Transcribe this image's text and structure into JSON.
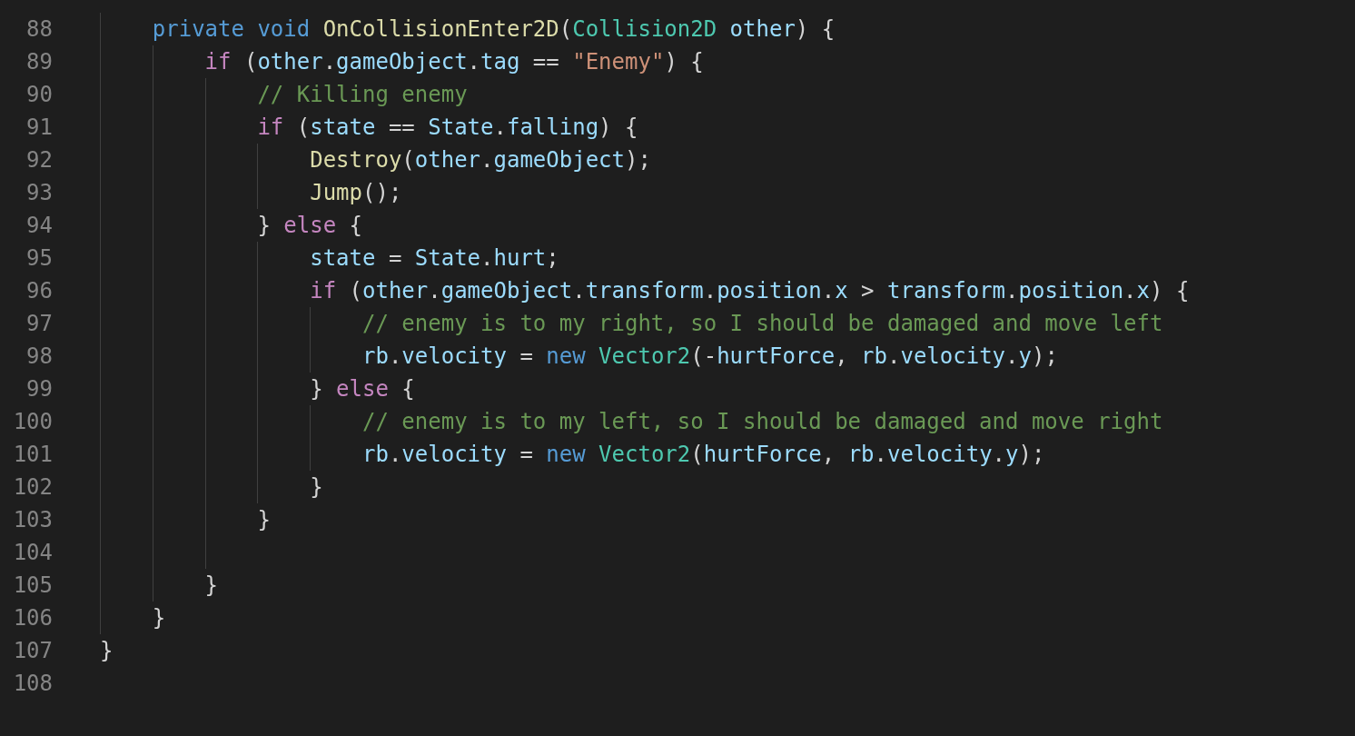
{
  "editor": {
    "lines": [
      {
        "children": [
          {
            "number": "88",
            "tokens": [
              {
                "kind": "keyword",
                "text": "private "
              },
              {
                "kind": "keyword",
                "text": "void "
              },
              {
                "kind": "function",
                "text": "OnCollisionEnter2D"
              },
              {
                "kind": "plain",
                "text": "("
              },
              {
                "kind": "type",
                "text": "Collision2D "
              },
              {
                "kind": "variable",
                "text": "other"
              },
              {
                "kind": "plain",
                "text": ") {"
              }
            ],
            "children": [
              {
                "number": "89",
                "tokens": [
                  {
                    "kind": "control",
                    "text": "if"
                  },
                  {
                    "kind": "plain",
                    "text": " ("
                  },
                  {
                    "kind": "variable",
                    "text": "other"
                  },
                  {
                    "kind": "plain",
                    "text": "."
                  },
                  {
                    "kind": "variable",
                    "text": "gameObject"
                  },
                  {
                    "kind": "plain",
                    "text": "."
                  },
                  {
                    "kind": "variable",
                    "text": "tag"
                  },
                  {
                    "kind": "plain",
                    "text": " == "
                  },
                  {
                    "kind": "string",
                    "text": "\"Enemy\""
                  },
                  {
                    "kind": "plain",
                    "text": ") {"
                  }
                ],
                "children": [
                  {
                    "number": "90",
                    "tokens": [
                      {
                        "kind": "comment",
                        "text": "// Killing enemy"
                      }
                    ]
                  },
                  {
                    "number": "91",
                    "tokens": [
                      {
                        "kind": "control",
                        "text": "if"
                      },
                      {
                        "kind": "plain",
                        "text": " ("
                      },
                      {
                        "kind": "variable",
                        "text": "state"
                      },
                      {
                        "kind": "plain",
                        "text": " == "
                      },
                      {
                        "kind": "variable",
                        "text": "State"
                      },
                      {
                        "kind": "plain",
                        "text": "."
                      },
                      {
                        "kind": "variable",
                        "text": "falling"
                      },
                      {
                        "kind": "plain",
                        "text": ") {"
                      }
                    ],
                    "children": [
                      {
                        "number": "92",
                        "tokens": [
                          {
                            "kind": "function",
                            "text": "Destroy"
                          },
                          {
                            "kind": "plain",
                            "text": "("
                          },
                          {
                            "kind": "variable",
                            "text": "other"
                          },
                          {
                            "kind": "plain",
                            "text": "."
                          },
                          {
                            "kind": "variable",
                            "text": "gameObject"
                          },
                          {
                            "kind": "plain",
                            "text": ");"
                          }
                        ]
                      },
                      {
                        "number": "93",
                        "tokens": [
                          {
                            "kind": "function",
                            "text": "Jump"
                          },
                          {
                            "kind": "plain",
                            "text": "();"
                          }
                        ]
                      }
                    ]
                  },
                  {
                    "number": "94",
                    "tokens": [
                      {
                        "kind": "plain",
                        "text": "} "
                      },
                      {
                        "kind": "control",
                        "text": "else"
                      },
                      {
                        "kind": "plain",
                        "text": " {"
                      }
                    ],
                    "children": [
                      {
                        "number": "95",
                        "tokens": [
                          {
                            "kind": "variable",
                            "text": "state"
                          },
                          {
                            "kind": "plain",
                            "text": " = "
                          },
                          {
                            "kind": "variable",
                            "text": "State"
                          },
                          {
                            "kind": "plain",
                            "text": "."
                          },
                          {
                            "kind": "variable",
                            "text": "hurt"
                          },
                          {
                            "kind": "plain",
                            "text": ";"
                          }
                        ]
                      },
                      {
                        "number": "96",
                        "tokens": [
                          {
                            "kind": "control",
                            "text": "if"
                          },
                          {
                            "kind": "plain",
                            "text": " ("
                          },
                          {
                            "kind": "variable",
                            "text": "other"
                          },
                          {
                            "kind": "plain",
                            "text": "."
                          },
                          {
                            "kind": "variable",
                            "text": "gameObject"
                          },
                          {
                            "kind": "plain",
                            "text": "."
                          },
                          {
                            "kind": "variable",
                            "text": "transform"
                          },
                          {
                            "kind": "plain",
                            "text": "."
                          },
                          {
                            "kind": "variable",
                            "text": "position"
                          },
                          {
                            "kind": "plain",
                            "text": "."
                          },
                          {
                            "kind": "variable",
                            "text": "x"
                          },
                          {
                            "kind": "plain",
                            "text": " > "
                          },
                          {
                            "kind": "variable",
                            "text": "transform"
                          },
                          {
                            "kind": "plain",
                            "text": "."
                          },
                          {
                            "kind": "variable",
                            "text": "position"
                          },
                          {
                            "kind": "plain",
                            "text": "."
                          },
                          {
                            "kind": "variable",
                            "text": "x"
                          },
                          {
                            "kind": "plain",
                            "text": ") {"
                          }
                        ],
                        "children": [
                          {
                            "number": "97",
                            "tokens": [
                              {
                                "kind": "comment",
                                "text": "// enemy is to my right, so I should be damaged and move left"
                              }
                            ]
                          },
                          {
                            "number": "98",
                            "tokens": [
                              {
                                "kind": "variable",
                                "text": "rb"
                              },
                              {
                                "kind": "plain",
                                "text": "."
                              },
                              {
                                "kind": "variable",
                                "text": "velocity"
                              },
                              {
                                "kind": "plain",
                                "text": " = "
                              },
                              {
                                "kind": "keyword",
                                "text": "new "
                              },
                              {
                                "kind": "type",
                                "text": "Vector2"
                              },
                              {
                                "kind": "plain",
                                "text": "(-"
                              },
                              {
                                "kind": "variable",
                                "text": "hurtForce"
                              },
                              {
                                "kind": "plain",
                                "text": ", "
                              },
                              {
                                "kind": "variable",
                                "text": "rb"
                              },
                              {
                                "kind": "plain",
                                "text": "."
                              },
                              {
                                "kind": "variable",
                                "text": "velocity"
                              },
                              {
                                "kind": "plain",
                                "text": "."
                              },
                              {
                                "kind": "variable",
                                "text": "y"
                              },
                              {
                                "kind": "plain",
                                "text": ");"
                              }
                            ]
                          }
                        ]
                      },
                      {
                        "number": "99",
                        "tokens": [
                          {
                            "kind": "plain",
                            "text": "} "
                          },
                          {
                            "kind": "control",
                            "text": "else"
                          },
                          {
                            "kind": "plain",
                            "text": " {"
                          }
                        ],
                        "children": [
                          {
                            "number": "100",
                            "tokens": [
                              {
                                "kind": "comment",
                                "text": "// enemy is to my left, so I should be damaged and move right"
                              }
                            ]
                          },
                          {
                            "number": "101",
                            "tokens": [
                              {
                                "kind": "variable",
                                "text": "rb"
                              },
                              {
                                "kind": "plain",
                                "text": "."
                              },
                              {
                                "kind": "variable",
                                "text": "velocity"
                              },
                              {
                                "kind": "plain",
                                "text": " = "
                              },
                              {
                                "kind": "keyword",
                                "text": "new "
                              },
                              {
                                "kind": "type",
                                "text": "Vector2"
                              },
                              {
                                "kind": "plain",
                                "text": "("
                              },
                              {
                                "kind": "variable",
                                "text": "hurtForce"
                              },
                              {
                                "kind": "plain",
                                "text": ", "
                              },
                              {
                                "kind": "variable",
                                "text": "rb"
                              },
                              {
                                "kind": "plain",
                                "text": "."
                              },
                              {
                                "kind": "variable",
                                "text": "velocity"
                              },
                              {
                                "kind": "plain",
                                "text": "."
                              },
                              {
                                "kind": "variable",
                                "text": "y"
                              },
                              {
                                "kind": "plain",
                                "text": ");"
                              }
                            ]
                          }
                        ]
                      },
                      {
                        "number": "102",
                        "tokens": [
                          {
                            "kind": "plain",
                            "text": "}"
                          }
                        ]
                      }
                    ]
                  },
                  {
                    "number": "103",
                    "tokens": [
                      {
                        "kind": "plain",
                        "text": "}"
                      }
                    ]
                  },
                  {
                    "number": "104"
                  }
                ]
              },
              {
                "number": "105",
                "tokens": [
                  {
                    "kind": "plain",
                    "text": "}"
                  }
                ]
              }
            ]
          },
          {
            "number": "106",
            "tokens": [
              {
                "kind": "plain",
                "text": "}"
              }
            ]
          }
        ]
      },
      {
        "number": "107",
        "tokens": [
          {
            "kind": "plain",
            "text": "}"
          }
        ]
      },
      {
        "number": "108"
      }
    ]
  }
}
